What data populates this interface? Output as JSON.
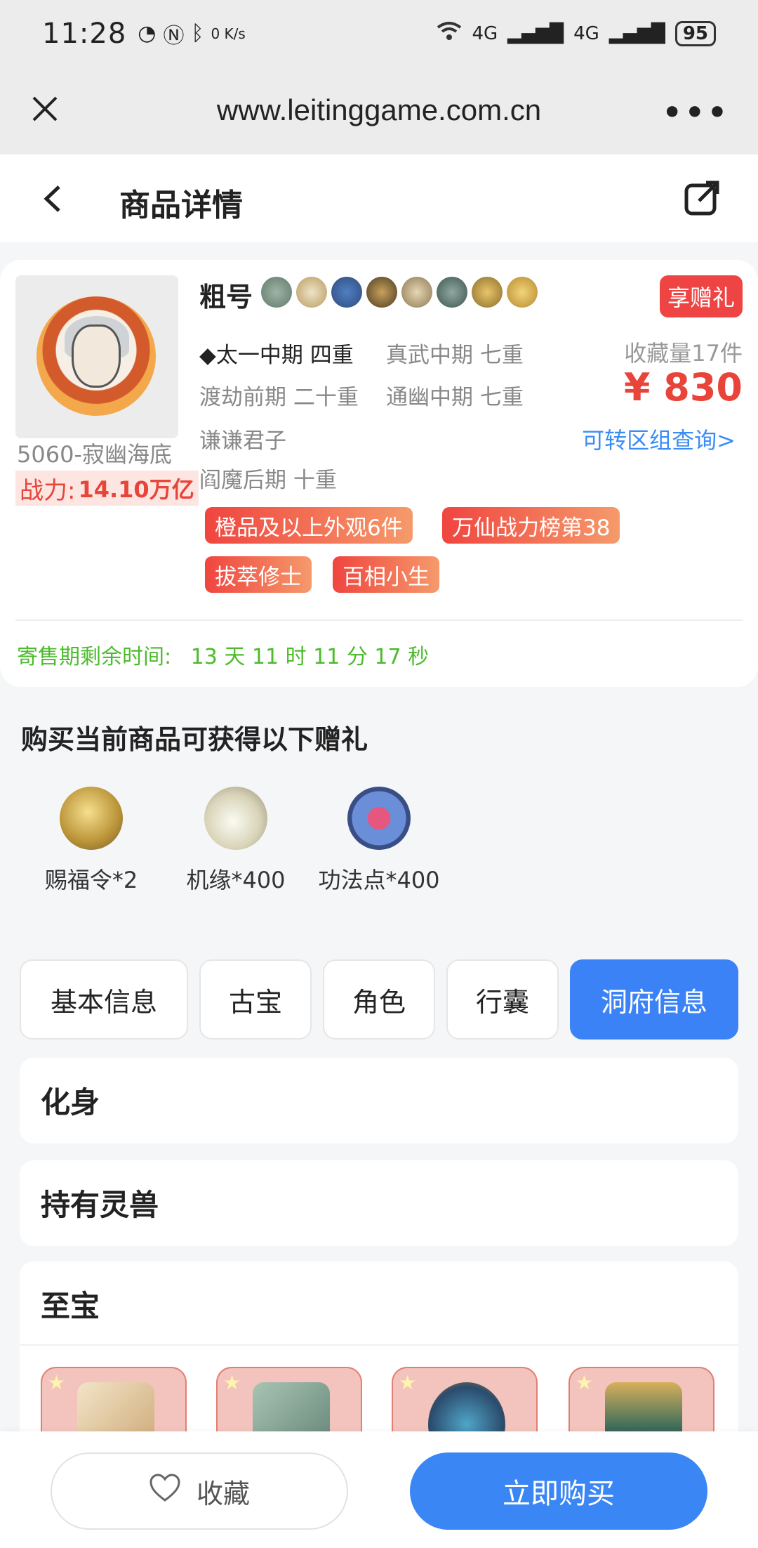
{
  "status_bar": {
    "time": "11:28",
    "net_speed": "0 K/s",
    "signal_1": "4G",
    "signal_2": "4G",
    "battery": "95"
  },
  "browser": {
    "url": "www.leitinggame.com.cn",
    "more_label": "•••"
  },
  "header": {
    "title": "商品详情"
  },
  "product": {
    "seller": "粗号",
    "gift_tag": "享赠礼",
    "server": "5060-寂幽海底",
    "power_label": "战力:",
    "power_value": "14.10万亿",
    "realms": [
      "◆太一中期 四重",
      "真武中期 七重",
      "渡劫前期 二十重",
      "通幽中期 七重",
      "谦谦君子",
      "阎魔后期 十重"
    ],
    "favorites": "收藏量17件",
    "price": "¥ 830",
    "transfer_link": "可转区组查询>",
    "tags": [
      "橙品及以上外观6件",
      "万仙战力榜第38",
      "拔萃修士",
      "百相小生"
    ],
    "countdown_label": "寄售期剩余时间:",
    "countdown_value": "13 天 11 时 11 分 17 秒"
  },
  "gifts": {
    "title": "购买当前商品可获得以下赠礼",
    "items": [
      {
        "label": "赐福令*2",
        "icon": "token-icon"
      },
      {
        "label": "机缘*400",
        "icon": "jade-icon"
      },
      {
        "label": "功法点*400",
        "icon": "orb-icon"
      }
    ]
  },
  "tabs": [
    "基本信息",
    "古宝",
    "角色",
    "行囊",
    "洞府信息"
  ],
  "active_tab": "洞府信息",
  "sections": {
    "avatar": "化身",
    "spirit_beast": "持有灵兽",
    "treasure": "至宝"
  },
  "bottom": {
    "favorite_label": "收藏",
    "buy_label": "立即购买"
  },
  "colors": {
    "accent": "#3b82f6",
    "price": "#e8443a",
    "countdown": "#4cbb2d",
    "link": "#3a8df5"
  }
}
